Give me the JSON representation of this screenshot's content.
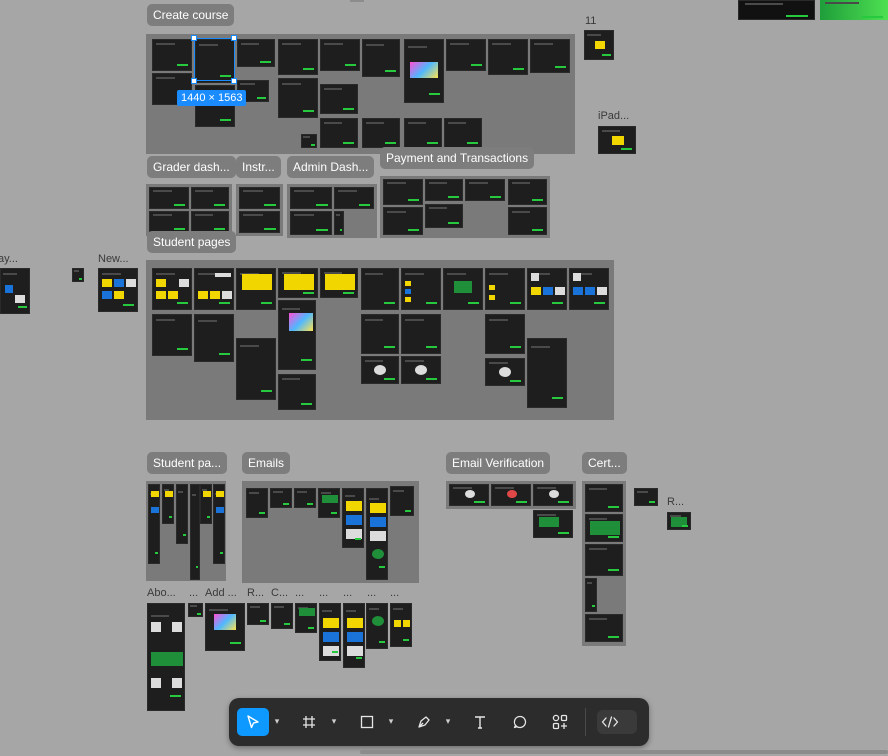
{
  "canvas": {
    "background": "#a6a6a6",
    "section_fill": "#7a7a7a",
    "selection_color": "#1a8cff"
  },
  "sections": {
    "create_course": "Create course",
    "grader_dash": "Grader dash...",
    "instr": "Instr...",
    "admin_dash": "Admin Dash...",
    "payment": "Payment and Transactions",
    "student_pages": "Student pages",
    "student_pa": "Student pa...",
    "emails": "Emails",
    "email_verification": "Email Verification",
    "cert": "Cert..."
  },
  "frame_labels": {
    "eleven": "11",
    "ipad": "iPad...",
    "ay": "ay...",
    "new": "New...",
    "r_right": "R...",
    "abo": "Abo...",
    "dots_1": "...",
    "add": "Add ...",
    "r_bottom": "R...",
    "c_bottom": "C...",
    "dots_2": "...",
    "dots_3": "...",
    "dots_4": "...",
    "dots_5": "...",
    "dots_6": "..."
  },
  "selection": {
    "dimensions": "1440 × 1563"
  },
  "toolbar": {
    "tools": [
      {
        "name": "move-tool",
        "icon": "cursor-arrow",
        "active": true
      },
      {
        "name": "frame-tool",
        "icon": "hash-frame",
        "active": false
      },
      {
        "name": "shape-tool",
        "icon": "rectangle",
        "active": false
      },
      {
        "name": "pen-tool",
        "icon": "pen",
        "active": false
      },
      {
        "name": "text-tool",
        "icon": "text-T",
        "active": false
      },
      {
        "name": "comment-tool",
        "icon": "speech-bubble",
        "active": false
      },
      {
        "name": "actions-tool",
        "icon": "shapes-plus",
        "active": false
      }
    ],
    "dev_mode_icon": "code-brackets",
    "accent": "#0d99ff"
  }
}
